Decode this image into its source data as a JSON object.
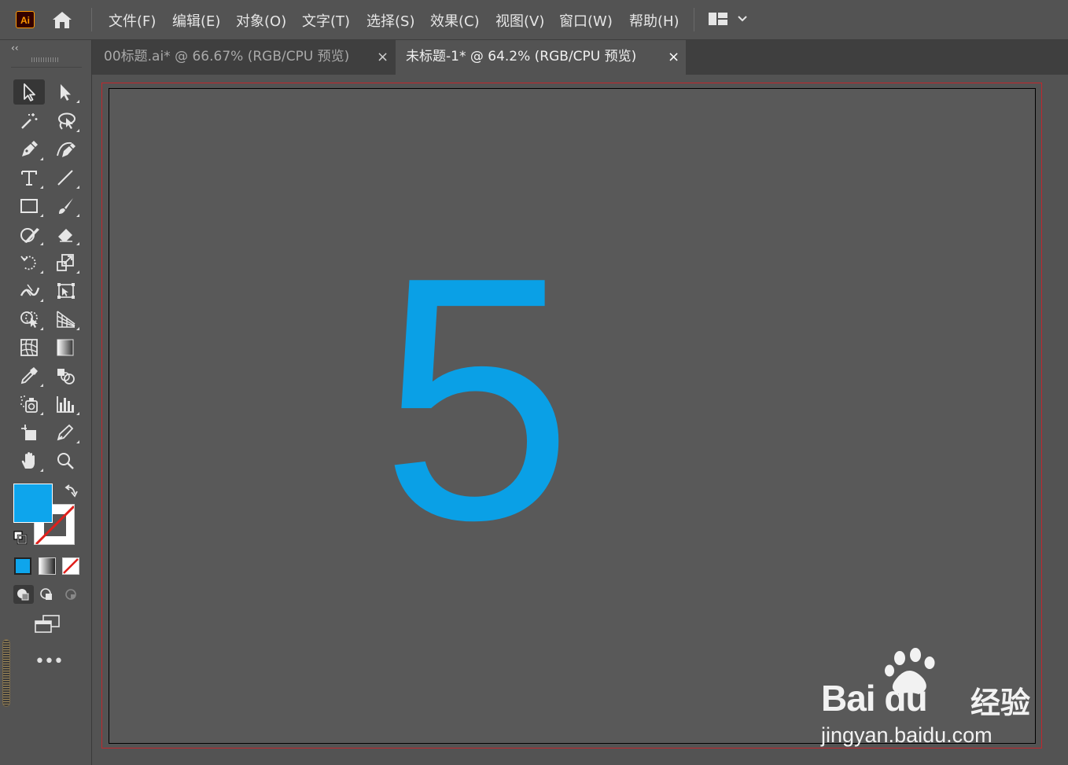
{
  "app": {
    "logo": "Ai",
    "home_icon": "home-icon"
  },
  "menu": [
    "文件(F)",
    "编辑(E)",
    "对象(O)",
    "文字(T)",
    "选择(S)",
    "效果(C)",
    "视图(V)",
    "窗口(W)",
    "帮助(H)"
  ],
  "workspace": {
    "icon": "workspace-layout-icon",
    "chevron": "chevron-down-icon"
  },
  "toolbar": {
    "collapse": "‹‹",
    "tools": [
      {
        "name": "selection-tool",
        "icon": "arrow-outline-icon",
        "active": true
      },
      {
        "name": "direct-selection-tool",
        "icon": "arrow-solid-icon"
      },
      {
        "name": "magic-wand-tool",
        "icon": "magic-wand-icon"
      },
      {
        "name": "lasso-tool",
        "icon": "lasso-icon"
      },
      {
        "name": "pen-tool",
        "icon": "pen-icon"
      },
      {
        "name": "curvature-tool",
        "icon": "curvature-pen-icon"
      },
      {
        "name": "type-tool",
        "icon": "type-icon"
      },
      {
        "name": "line-segment-tool",
        "icon": "line-icon"
      },
      {
        "name": "rectangle-tool",
        "icon": "rectangle-icon"
      },
      {
        "name": "paintbrush-tool",
        "icon": "paintbrush-icon"
      },
      {
        "name": "shaper-tool",
        "icon": "shaper-icon"
      },
      {
        "name": "eraser-tool",
        "icon": "eraser-icon"
      },
      {
        "name": "rotate-tool",
        "icon": "rotate-icon"
      },
      {
        "name": "scale-tool",
        "icon": "scale-icon"
      },
      {
        "name": "width-tool",
        "icon": "width-icon"
      },
      {
        "name": "free-transform-tool",
        "icon": "free-transform-icon"
      },
      {
        "name": "shape-builder-tool",
        "icon": "shape-builder-icon"
      },
      {
        "name": "perspective-grid-tool",
        "icon": "perspective-grid-icon"
      },
      {
        "name": "mesh-tool",
        "icon": "mesh-icon"
      },
      {
        "name": "gradient-tool",
        "icon": "gradient-icon"
      },
      {
        "name": "eyedropper-tool",
        "icon": "eyedropper-icon"
      },
      {
        "name": "blend-tool",
        "icon": "blend-icon"
      },
      {
        "name": "symbol-sprayer-tool",
        "icon": "symbol-sprayer-icon"
      },
      {
        "name": "column-graph-tool",
        "icon": "column-graph-icon"
      },
      {
        "name": "artboard-tool",
        "icon": "artboard-icon"
      },
      {
        "name": "slice-tool",
        "icon": "slice-icon"
      },
      {
        "name": "hand-tool",
        "icon": "hand-icon"
      },
      {
        "name": "zoom-tool",
        "icon": "zoom-icon"
      }
    ],
    "fill_color": "#0ea5ec",
    "stroke": "none",
    "more": "•••"
  },
  "tabs": [
    {
      "label": "00标题.ai* @ 66.67% (RGB/CPU 预览)",
      "close": "×",
      "active": false
    },
    {
      "label": "未标题-1* @ 64.2% (RGB/CPU 预览)",
      "close": "×",
      "active": true
    }
  ],
  "canvas": {
    "text": "5",
    "text_color": "#0aa0e6"
  },
  "watermark": {
    "brand": "Bai du",
    "product": "经验",
    "url": "jingyan.baidu.com"
  },
  "colors": {
    "bg": "#535353",
    "artboard": "#595959",
    "bleed": "#c1272d",
    "tabbar": "#3f3f3f",
    "active_tab": "#535353"
  }
}
